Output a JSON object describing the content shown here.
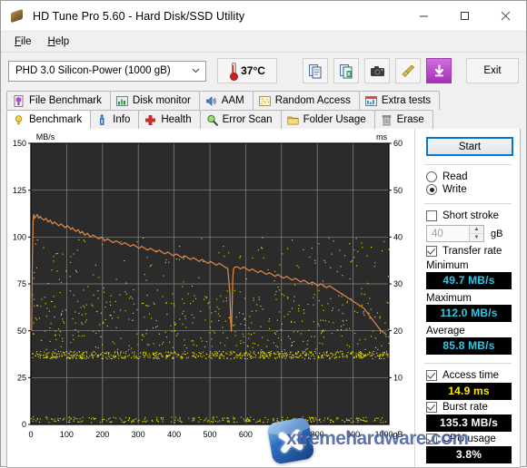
{
  "window": {
    "title": "HD Tune Pro 5.60 - Hard Disk/SSD Utility",
    "icon": "hard-disk-icon",
    "minimize": "—",
    "maximize": "□",
    "close": "✕"
  },
  "menu": {
    "items": [
      {
        "label": "File",
        "accel": "F"
      },
      {
        "label": "Help",
        "accel": "H"
      }
    ]
  },
  "toolbar": {
    "drive": {
      "value": "PHD 3.0 Silicon-Power (1000 gB)",
      "chevron": "⌄"
    },
    "temperature": "37°C",
    "buttons": [
      {
        "name": "copy-to-clipboard-button",
        "icon": "copy-document-icon"
      },
      {
        "name": "export-excel-button",
        "icon": "export-spreadsheet-icon"
      },
      {
        "name": "screenshot-button",
        "icon": "camera-icon"
      },
      {
        "name": "broom-button",
        "icon": "broom-icon"
      },
      {
        "name": "save-download-button",
        "icon": "download-arrow-icon"
      }
    ],
    "exit_label": "Exit"
  },
  "tabs": {
    "top_row": [
      {
        "label": "File Benchmark",
        "icon": "purple-lightbulb-icon",
        "active": false
      },
      {
        "label": "Disk monitor",
        "icon": "bar-chart-icon",
        "active": false
      },
      {
        "label": "AAM",
        "icon": "speaker-icon",
        "active": false
      },
      {
        "label": "Random Access",
        "icon": "scatter-dots-icon",
        "active": false
      },
      {
        "label": "Extra tests",
        "icon": "table-chart-icon",
        "active": false
      }
    ],
    "bottom_row": [
      {
        "label": "Benchmark",
        "icon": "yellow-lightbulb-icon",
        "active": true
      },
      {
        "label": "Info",
        "icon": "info-icon",
        "active": false
      },
      {
        "label": "Health",
        "icon": "red-cross-icon",
        "active": false
      },
      {
        "label": "Error Scan",
        "icon": "magnifier-icon",
        "active": false
      },
      {
        "label": "Folder Usage",
        "icon": "folder-icon",
        "active": false
      },
      {
        "label": "Erase",
        "icon": "trash-icon",
        "active": false
      }
    ]
  },
  "sidebar": {
    "start_label": "Start",
    "mode": {
      "read_label": "Read",
      "write_label": "Write",
      "selected": "Write"
    },
    "short_stroke": {
      "label": "Short stroke",
      "checked": false,
      "value": "40",
      "unit": "gB"
    },
    "transfer_rate": {
      "label": "Transfer rate",
      "checked": true
    },
    "results": [
      {
        "label": "Minimum",
        "value": "49.7 MB/s",
        "color": "cyan"
      },
      {
        "label": "Maximum",
        "value": "112.0 MB/s",
        "color": "cyan"
      },
      {
        "label": "Average",
        "value": "85.8 MB/s",
        "color": "cyan"
      }
    ],
    "access_time": {
      "label": "Access time",
      "checked": true,
      "value": "14.9 ms",
      "color": "yellow"
    },
    "burst_rate": {
      "label": "Burst rate",
      "checked": true,
      "value": "135.3 MB/s",
      "color": "white"
    },
    "cpu_usage": {
      "label": "CPU usage",
      "checked": true,
      "value": "3.8%",
      "color": "white"
    }
  },
  "watermark": {
    "text": "xtremehardware.com",
    "logo": "x-logo"
  },
  "chart_data": {
    "type": "line",
    "title": "",
    "xlabel": "1000gB",
    "ylabel": "MB/s",
    "y2label": "ms",
    "xlim": [
      0,
      1000
    ],
    "ylim": [
      0,
      150
    ],
    "y2lim": [
      0,
      60
    ],
    "grid": true,
    "background": "#2b2b2b",
    "xticks": [
      0,
      100,
      200,
      300,
      400,
      500,
      600,
      700,
      800,
      900,
      1000
    ],
    "xticklabels": [
      "0",
      "100",
      "200",
      "300",
      "400",
      "500",
      "600",
      "700",
      "800",
      "900",
      "1000gB"
    ],
    "yticks": [
      0,
      25,
      50,
      75,
      100,
      125,
      150
    ],
    "y2ticks": [
      10,
      20,
      30,
      40,
      50,
      60
    ],
    "series": [
      {
        "name": "Transfer rate",
        "type": "line",
        "color": "#e08a4a",
        "axis": "left",
        "units": "MB/s",
        "x": [
          2,
          4,
          6,
          8,
          10,
          14,
          18,
          22,
          26,
          30,
          36,
          42,
          48,
          54,
          60,
          66,
          72,
          78,
          84,
          90,
          96,
          102,
          108,
          112,
          116,
          120,
          126,
          132,
          138,
          144,
          150,
          158,
          166,
          174,
          182,
          190,
          198,
          206,
          214,
          222,
          230,
          238,
          246,
          254,
          262,
          270,
          278,
          286,
          294,
          302,
          310,
          318,
          326,
          334,
          342,
          350,
          358,
          366,
          374,
          382,
          390,
          398,
          406,
          414,
          422,
          430,
          438,
          446,
          454,
          462,
          470,
          478,
          486,
          494,
          502,
          510,
          518,
          526,
          534,
          542,
          550,
          556,
          558,
          560,
          562,
          564,
          566,
          570,
          578,
          586,
          594,
          602,
          610,
          618,
          626,
          634,
          642,
          650,
          658,
          666,
          674,
          682,
          690,
          698,
          706,
          714,
          722,
          730,
          738,
          746,
          754,
          762,
          770,
          778,
          786,
          794,
          802,
          810,
          818,
          826,
          834,
          842,
          850,
          858,
          866,
          874,
          882,
          890,
          898,
          906,
          914,
          922,
          930,
          938,
          946,
          954,
          962,
          970,
          978,
          986,
          992,
          998
        ],
        "y": [
          50,
          88,
          108,
          112,
          110,
          111,
          112,
          110,
          111,
          110,
          109,
          110,
          108,
          109,
          107,
          108,
          107,
          106,
          107,
          106,
          105,
          106,
          105,
          104,
          105,
          104,
          103,
          104,
          102,
          103,
          101,
          102,
          100,
          101,
          100,
          99,
          100,
          98,
          99,
          98,
          97,
          98,
          97,
          96,
          97,
          96,
          95,
          96,
          95,
          94,
          95,
          94,
          93,
          94,
          93,
          92,
          93,
          92,
          91,
          92,
          91,
          90,
          91,
          90,
          89,
          90,
          89,
          88,
          89,
          88,
          87,
          88,
          87,
          86,
          87,
          86,
          85,
          86,
          85,
          84,
          83,
          70,
          55,
          49.7,
          62,
          78,
          83,
          84,
          84,
          83,
          84,
          83,
          82,
          83,
          82,
          81,
          82,
          81,
          80,
          81,
          80,
          79,
          80,
          79,
          78,
          79,
          78,
          77,
          78,
          77,
          76,
          77,
          76,
          75,
          76,
          75,
          74,
          75,
          74,
          73,
          74,
          73,
          72,
          71,
          70,
          69,
          68,
          67,
          66,
          65,
          64,
          63,
          62,
          60,
          58,
          56,
          54,
          52,
          50,
          49,
          48
        ]
      },
      {
        "name": "Access time",
        "type": "scatter",
        "color": "#ebe800",
        "axis": "right",
        "units": "ms",
        "note": "Scatter cloud of per-sample access times, dense band around 14-15 ms with spread up to ~30 ms",
        "mean": 14.9
      }
    ]
  }
}
